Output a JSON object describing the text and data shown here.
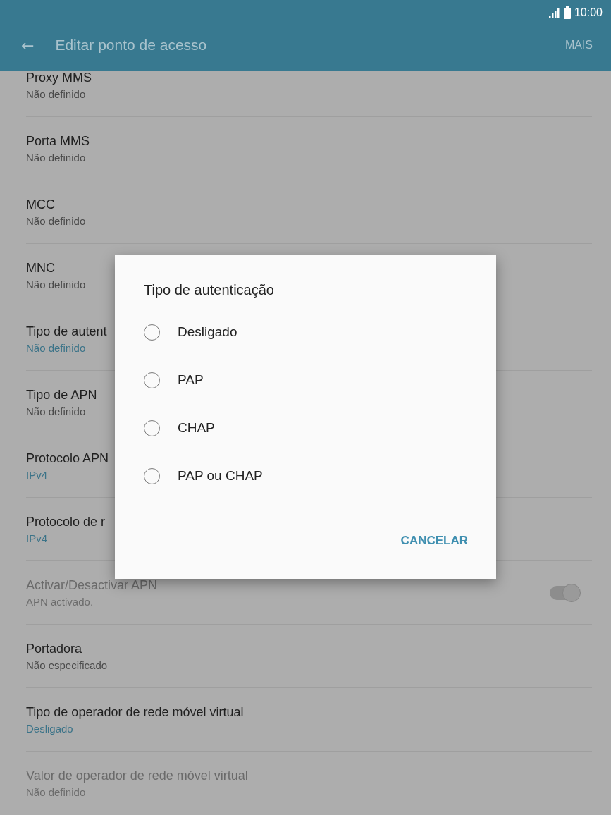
{
  "status_bar": {
    "time": "10:00"
  },
  "app_bar": {
    "back": "←",
    "title": "Editar ponto de acesso",
    "action": "MAIS"
  },
  "settings": [
    {
      "title": "Proxy MMS",
      "value": "Não definido",
      "value_highlighted": false,
      "disabled": false
    },
    {
      "title": "Porta MMS",
      "value": "Não definido",
      "value_highlighted": false,
      "disabled": false
    },
    {
      "title": "MCC",
      "value": "Não definido",
      "value_highlighted": false,
      "disabled": false
    },
    {
      "title": "MNC",
      "value": "Não definido",
      "value_highlighted": false,
      "disabled": false
    },
    {
      "title": "Tipo de autent",
      "value": "Não definido",
      "value_highlighted": true,
      "disabled": false
    },
    {
      "title": "Tipo de APN",
      "value": "Não definido",
      "value_highlighted": false,
      "disabled": false
    },
    {
      "title": "Protocolo APN",
      "value": "IPv4",
      "value_highlighted": true,
      "disabled": false
    },
    {
      "title": "Protocolo de r",
      "value": "IPv4",
      "value_highlighted": true,
      "disabled": false
    },
    {
      "title": "Activar/Desactivar APN",
      "value": "APN activado.",
      "value_highlighted": false,
      "disabled": true,
      "switch": {
        "on": true
      }
    },
    {
      "title": "Portadora",
      "value": "Não especificado",
      "value_highlighted": false,
      "disabled": false
    },
    {
      "title": "Tipo de operador de rede móvel virtual",
      "value": "Desligado",
      "value_highlighted": true,
      "disabled": false
    },
    {
      "title": "Valor de operador de rede móvel virtual",
      "value": "Não definido",
      "value_highlighted": false,
      "disabled": true
    }
  ],
  "dialog": {
    "title": "Tipo de autenticação",
    "options": [
      {
        "label": "Desligado",
        "selected": false
      },
      {
        "label": "PAP",
        "selected": false
      },
      {
        "label": "CHAP",
        "selected": false
      },
      {
        "label": "PAP ou CHAP",
        "selected": false
      }
    ],
    "buttons": [
      "CANCELAR"
    ]
  }
}
